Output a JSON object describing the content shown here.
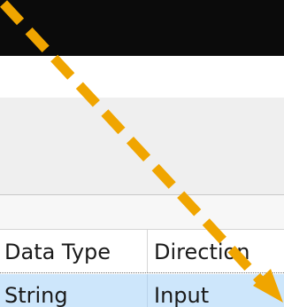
{
  "grid": {
    "columns": [
      {
        "label": "Data Type"
      },
      {
        "label": "Direction"
      }
    ],
    "rows": [
      {
        "data_type": "String",
        "direction": "Input",
        "selected": true
      }
    ]
  },
  "annotation": {
    "type": "dashed-arrow",
    "color": "#f0a500"
  }
}
